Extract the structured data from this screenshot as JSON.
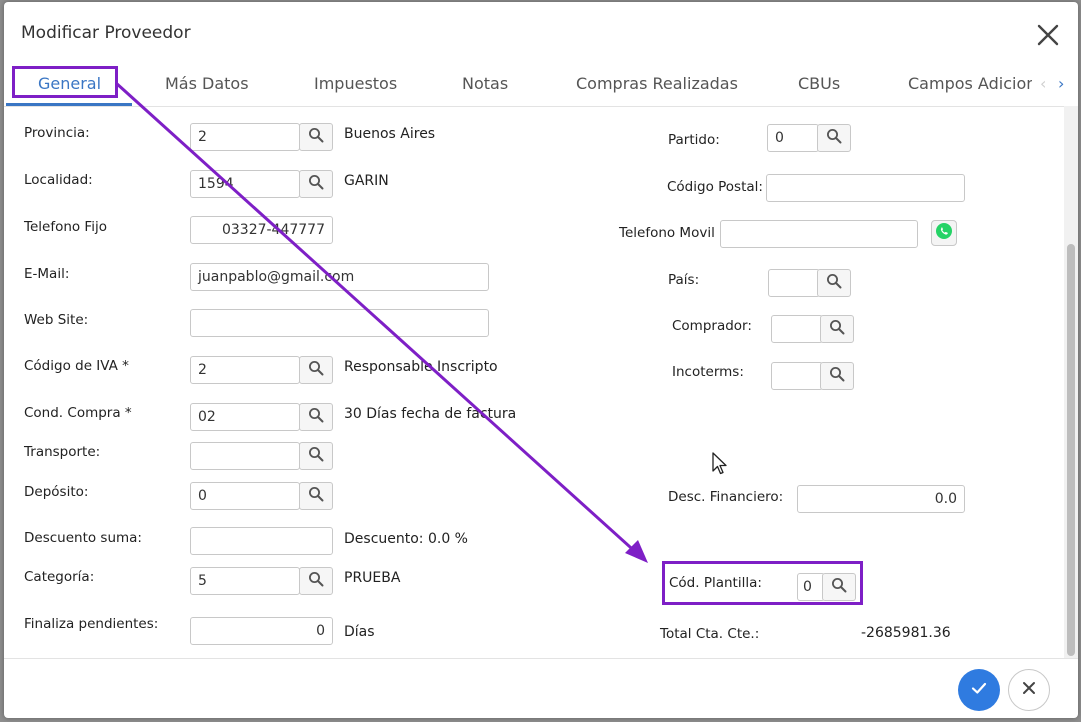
{
  "dialog": {
    "title": "Modificar Proveedor"
  },
  "tabs": [
    {
      "label": "General"
    },
    {
      "label": "Más Datos"
    },
    {
      "label": "Impuestos"
    },
    {
      "label": "Notas"
    },
    {
      "label": "Compras Realizadas"
    },
    {
      "label": "CBUs"
    },
    {
      "label": "Campos Adicion"
    }
  ],
  "left": {
    "provincia": {
      "label": "Provincia:",
      "code": "2",
      "desc": "Buenos Aires"
    },
    "localidad": {
      "label": "Localidad:",
      "code": "1594",
      "desc": "GARIN"
    },
    "telefono_fijo": {
      "label": "Telefono Fijo",
      "value": "03327-447777"
    },
    "email": {
      "label": "E-Mail:",
      "value": "juanpablo@gmail.com"
    },
    "web_site": {
      "label": "Web Site:",
      "value": ""
    },
    "codigo_iva": {
      "label": "Código de IVA *",
      "code": "2",
      "desc": "Responsable Inscripto"
    },
    "cond_compra": {
      "label": "Cond. Compra *",
      "code": "02",
      "desc": "30 Días fecha de factura"
    },
    "transporte": {
      "label": "Transporte:",
      "code": ""
    },
    "deposito": {
      "label": "Depósito:",
      "code": "0"
    },
    "descuento_suma": {
      "label": "Descuento suma:",
      "value": "",
      "desc": "Descuento: 0.0 %"
    },
    "categoria": {
      "label": "Categoría:",
      "code": "5",
      "desc": "PRUEBA"
    },
    "finaliza_pendientes": {
      "label": "Finaliza pendientes:",
      "value": "0",
      "desc": "Días"
    }
  },
  "right": {
    "partido": {
      "label": "Partido:",
      "code": "0"
    },
    "codigo_postal": {
      "label": "Código Postal:",
      "value": ""
    },
    "telefono_movil": {
      "label": "Telefono Movil",
      "value": ""
    },
    "pais": {
      "label": "País:",
      "code": ""
    },
    "comprador": {
      "label": "Comprador:",
      "code": ""
    },
    "incoterms": {
      "label": "Incoterms:",
      "code": ""
    },
    "desc_financiero": {
      "label": "Desc. Financiero:",
      "value": "0.0"
    },
    "cod_plantilla": {
      "label": "Cód. Plantilla:",
      "code": "0"
    },
    "total_cta_cte": {
      "label": "Total Cta. Cte.:",
      "value": "-2685981.36"
    }
  },
  "colors": {
    "accent": "#3a76c4",
    "highlight": "#7e1fc6",
    "ok_button": "#2f7be0",
    "whatsapp": "#25d366"
  }
}
